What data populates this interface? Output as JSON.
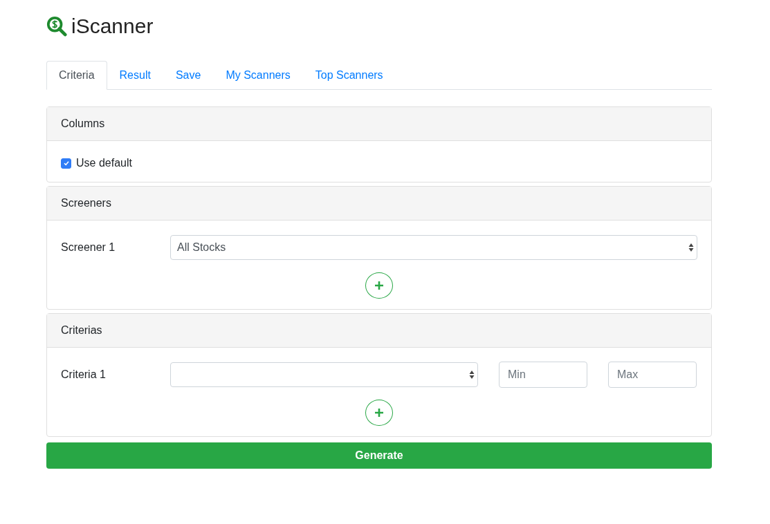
{
  "app": {
    "title": "iScanner"
  },
  "tabs": [
    {
      "label": "Criteria",
      "selected": true
    },
    {
      "label": "Result",
      "selected": false
    },
    {
      "label": "Save",
      "selected": false
    },
    {
      "label": "My Scanners",
      "selected": false
    },
    {
      "label": "Top Scanners",
      "selected": false
    }
  ],
  "columns": {
    "title": "Columns",
    "use_default": {
      "label": "Use default",
      "checked": true
    }
  },
  "screeners": {
    "title": "Screeners",
    "rows": [
      {
        "label": "Screener 1",
        "value": "All Stocks"
      }
    ]
  },
  "criterias": {
    "title": "Criterias",
    "rows": [
      {
        "label": "Criteria 1",
        "min_placeholder": "Min",
        "max_placeholder": "Max"
      }
    ]
  },
  "generate_button": "Generate"
}
